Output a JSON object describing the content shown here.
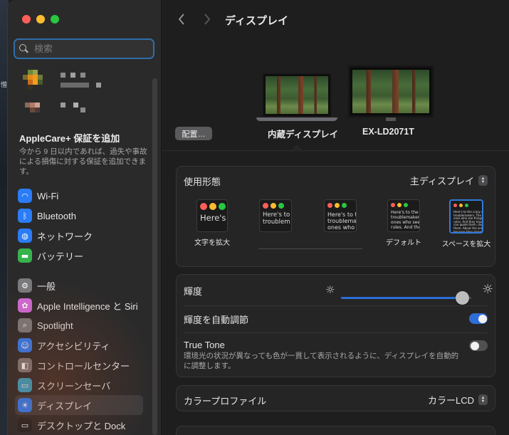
{
  "desktop": {
    "edge_text": "憎"
  },
  "window": {
    "title": "ディスプレイ"
  },
  "sidebar": {
    "search": {
      "placeholder": "検索",
      "value": ""
    },
    "applecare": {
      "title": "AppleCare+ 保証を追加",
      "description": "今から 9 日以内であれば、過失や事故による損傷に対する保証を追加できます。"
    },
    "items": [
      {
        "label": "Wi-Fi",
        "icon": "wifi-icon",
        "color": "#2b7cf6"
      },
      {
        "label": "Bluetooth",
        "icon": "bluetooth-icon",
        "color": "#2b7cf6"
      },
      {
        "label": "ネットワーク",
        "icon": "globe-icon",
        "color": "#2b7cf6"
      },
      {
        "label": "バッテリー",
        "icon": "battery-icon",
        "color": "#37b24d"
      },
      {
        "label": "一般",
        "icon": "gear-icon",
        "color": "#7a7a7c"
      },
      {
        "label": "Apple Intelligence と Siri",
        "icon": "siri-icon",
        "color": "#d06ad6"
      },
      {
        "label": "Spotlight",
        "icon": "magnifier-icon",
        "color": "#7a7a7c"
      },
      {
        "label": "アクセシビリティ",
        "icon": "accessibility-icon",
        "color": "#2b7cf6"
      },
      {
        "label": "コントロールセンター",
        "icon": "control-center-icon",
        "color": "#7a7a7c"
      },
      {
        "label": "スクリーンセーバ",
        "icon": "screensaver-icon",
        "color": "#33a3c9"
      },
      {
        "label": "ディスプレイ",
        "icon": "display-sun-icon",
        "color": "#2b7cf6",
        "selected": true
      },
      {
        "label": "デスクトップと Dock",
        "icon": "dock-icon",
        "color": "#222222"
      }
    ]
  },
  "main": {
    "toolbar": {
      "title": "ディスプレイ"
    },
    "displays": {
      "arrange_label": "配置…",
      "builtin_name": "内蔵ディスプレイ",
      "external_name": "EX-LD2071T"
    },
    "usage": {
      "label": "使用形態",
      "value": "主ディスプレイ"
    },
    "resolution": {
      "options": [
        {
          "label": "文字を拡大",
          "sample": "Here's"
        },
        {
          "label": "",
          "sample": "Here's to\ntroublem"
        },
        {
          "label": "",
          "sample": "Here's to t\ntroublema\nones who"
        },
        {
          "label": "デフォルト",
          "sample": "Here's to the cr\ntroublemakers.\nones who see th\nrules. And they"
        },
        {
          "label": "スペースを拡大",
          "sample": "Here's to the crazy ones\ntroublemakers. The rou\nones who see things diff\nrules. And they have no\ncan quote them, disagre\nthem. About the only th\nbecause they change th",
          "selected": true
        }
      ]
    },
    "brightness": {
      "label": "輝度",
      "level": 0.93
    },
    "auto_brightness": {
      "label": "輝度を自動調節",
      "on": true
    },
    "true_tone": {
      "label": "True Tone",
      "on": false,
      "description": "環境光の状況が異なっても色が一貫して表示されるように、ディスプレイを自動的に調整します。"
    },
    "color_profile": {
      "label": "カラープロファイル",
      "value": "カラーLCD"
    }
  }
}
